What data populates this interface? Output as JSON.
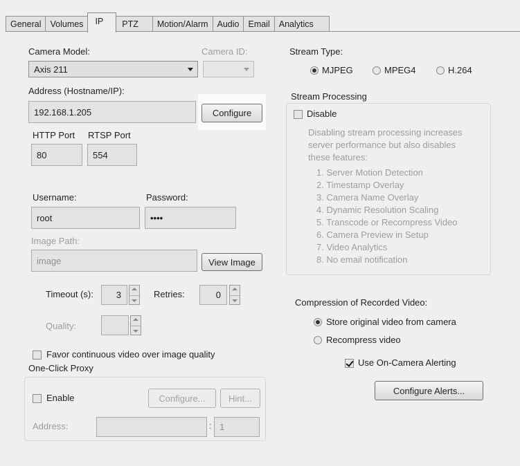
{
  "tabs": [
    "General",
    "Volumes",
    "IP",
    "PTZ",
    "Motion/Alarm",
    "Audio",
    "Email",
    "Analytics"
  ],
  "active_tab": "IP",
  "camera_model": {
    "label": "Camera Model:",
    "value": "Axis 211"
  },
  "camera_id": {
    "label": "Camera ID:",
    "value": ""
  },
  "address": {
    "label": "Address (Hostname/IP):",
    "value": "192.168.1.205",
    "configure_button": "Configure"
  },
  "http_port": {
    "label": "HTTP Port",
    "value": "80"
  },
  "rtsp_port": {
    "label": "RTSP Port",
    "value": "554"
  },
  "username": {
    "label": "Username:",
    "value": "root"
  },
  "password": {
    "label": "Password:",
    "value": "••••"
  },
  "image_path": {
    "label": "Image Path:",
    "value": "image",
    "view_button": "View Image"
  },
  "timeout": {
    "label": "Timeout (s):",
    "value": "3"
  },
  "retries": {
    "label": "Retries:",
    "value": "0"
  },
  "quality": {
    "label": "Quality:",
    "value": ""
  },
  "favor_continuous": {
    "label": "Favor continuous video over image quality",
    "checked": false
  },
  "one_click_proxy": {
    "title": "One-Click Proxy",
    "enable_label": "Enable",
    "configure_button": "Configure...",
    "hint_button": "Hint...",
    "address_label": "Address:",
    "address_value": "",
    "port_value": "1"
  },
  "stream_type": {
    "label": "Stream Type:",
    "options": [
      "MJPEG",
      "MPEG4",
      "H.264"
    ],
    "selected": "MJPEG"
  },
  "stream_processing": {
    "title": "Stream Processing",
    "disable_label": "Disable",
    "description_lines": [
      "Disabling stream processing increases",
      "server performance but also disables",
      "these features:"
    ],
    "features": [
      "1. Server Motion Detection",
      "2. Timestamp Overlay",
      "3. Camera Name Overlay",
      "4. Dynamic Resolution Scaling",
      "5. Transcode or Recompress Video",
      "6. Camera Preview in Setup",
      "7. Video Analytics",
      "8. No email notification"
    ]
  },
  "compression": {
    "label": "Compression of Recorded Video:",
    "options": [
      "Store original video from camera",
      "Recompress video"
    ],
    "selected": "Store original video from camera",
    "on_camera_alerting_label": "Use On-Camera Alerting",
    "on_camera_alerting_checked": true,
    "configure_alerts_button": "Configure Alerts..."
  }
}
